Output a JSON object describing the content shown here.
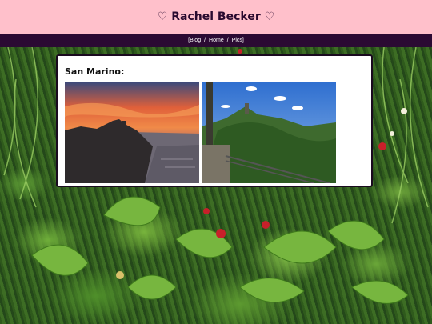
{
  "header": {
    "title": "♡ Rachel Becker ♡"
  },
  "nav": {
    "open": "[",
    "links": [
      "Blog",
      "Home",
      "Pics"
    ],
    "separator": "/",
    "close": "]"
  },
  "card": {
    "title": "San Marino:",
    "photos": [
      {
        "subject": "sunset over rocky cliff with tower"
      },
      {
        "subject": "green hilltop with tower and blue sky"
      }
    ]
  }
}
